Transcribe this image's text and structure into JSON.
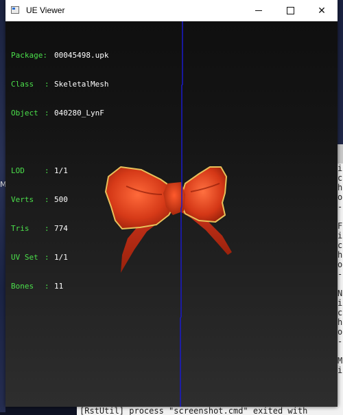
{
  "window": {
    "title": "UE Viewer",
    "minimize_glyph": "minimize-icon",
    "maximize_glyph": "maximize-icon",
    "close_glyph": "✕"
  },
  "mesh_info": {
    "package_label": "Package:",
    "package_value": "00045498.upk",
    "class_label": "Class",
    "class_value": "SkeletalMesh",
    "object_label": "Object",
    "object_value": "040280_LynF",
    "lod_label": "LOD",
    "lod_value": "1/1",
    "verts_label": "Verts",
    "verts_value": "500",
    "tris_label": "Tris",
    "tris_value": "774",
    "uvset_label": "UV Set",
    "uvset_value": "1/1",
    "bones_label": "Bones",
    "bones_value": "11"
  },
  "background_console": {
    "lines": [
      "i",
      "c",
      "h",
      "o",
      "-",
      "",
      "F",
      "i",
      "c",
      "h",
      "o",
      "-",
      "",
      "N",
      "i",
      "c",
      "h",
      "o",
      "-",
      "",
      "M",
      "i"
    ],
    "status": "[RstUtil] process \"screenshot.cmd\" exited with"
  },
  "desktop": {
    "left_char": "M"
  },
  "colors": {
    "info_label": "#4be04b",
    "info_value": "#ffffff",
    "axis_line": "#1a1acc",
    "bow_primary": "#d9391a",
    "bow_edge": "#e8c15a"
  }
}
